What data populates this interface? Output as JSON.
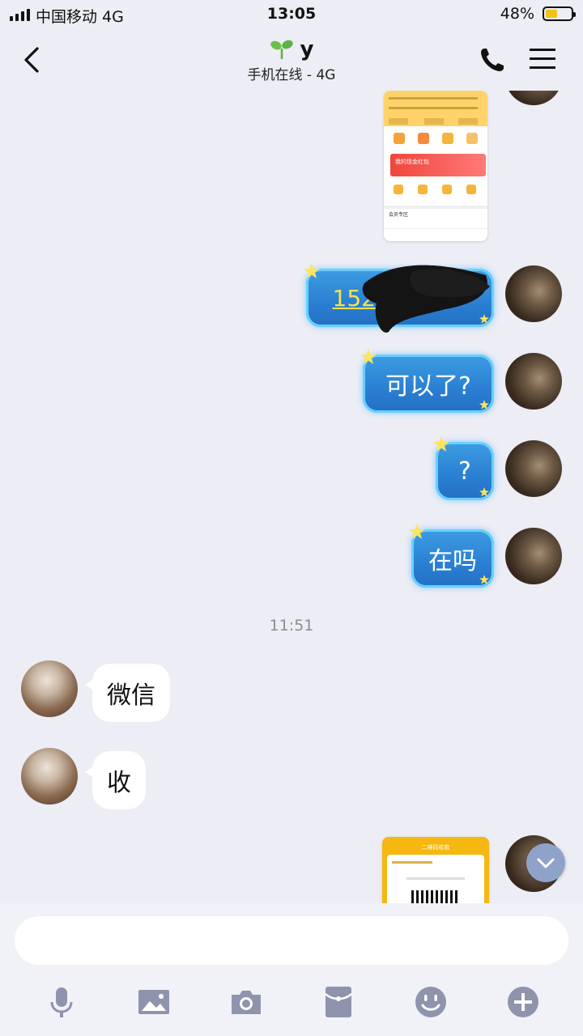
{
  "status_bar": {
    "carrier": "中国移动   4G",
    "time": "13:05",
    "battery": "48%",
    "battery_level": 0.48
  },
  "header": {
    "contact_name": "y",
    "status": "手机在线 - 4G"
  },
  "messages": [
    {
      "sender": "me",
      "type": "image",
      "content": "screenshot-of-app"
    },
    {
      "sender": "me",
      "type": "text",
      "text": "152624"
    },
    {
      "sender": "me",
      "type": "text",
      "text": "可以了?"
    },
    {
      "sender": "me",
      "type": "text",
      "text": "?"
    },
    {
      "sender": "me",
      "type": "text",
      "text": "在吗"
    },
    {
      "type": "timestamp",
      "text": "11:51"
    },
    {
      "sender": "other",
      "type": "text",
      "text": "微信"
    },
    {
      "sender": "other",
      "type": "text",
      "text": "收"
    },
    {
      "sender": "me",
      "type": "image",
      "content": "qr-code-screenshot"
    }
  ],
  "screenshot_1": {
    "promo_text": "我的现金红包",
    "section_text": "会员专区"
  },
  "screenshot_2": {
    "title": "二维码收款"
  },
  "toolbar": {
    "icons": [
      "microphone-icon",
      "image-icon",
      "camera-icon",
      "red-packet-icon",
      "emoji-icon",
      "plus-icon"
    ]
  },
  "colors": {
    "background": "#ecedf5",
    "bubble_me": "#2a7fd2",
    "bubble_glow": "#68d0ff",
    "bubble_other": "#ffffff",
    "timestamp": "#8a8d99",
    "toolbar_icon": "#8f94ad"
  }
}
